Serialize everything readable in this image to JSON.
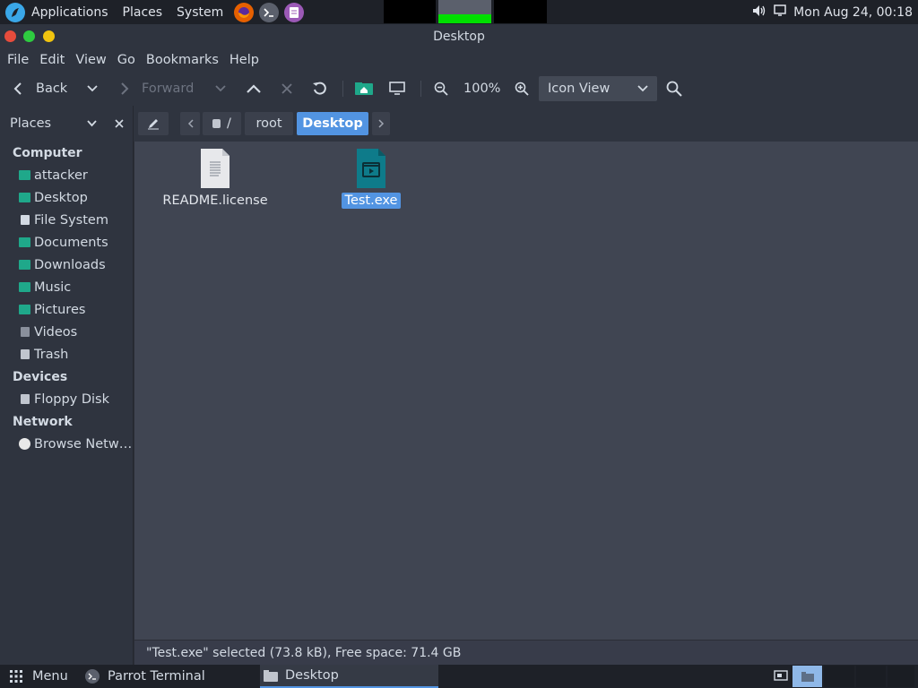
{
  "top_panel": {
    "applications": "Applications",
    "places": "Places",
    "system": "System",
    "launchers": [
      "firefox-icon",
      "terminal-icon",
      "text-editor-icon"
    ],
    "clock": "Mon Aug 24, 00:18"
  },
  "window": {
    "title": "Desktop"
  },
  "menubar": {
    "file": "File",
    "edit": "Edit",
    "view": "View",
    "go": "Go",
    "bookmarks": "Bookmarks",
    "help": "Help"
  },
  "toolbar": {
    "back": "Back",
    "forward": "Forward",
    "zoom": "100%",
    "view_mode": "Icon View"
  },
  "sidebar": {
    "header": "Places",
    "sections": [
      {
        "title": "Computer"
      },
      {
        "title": "Devices"
      },
      {
        "title": "Network"
      }
    ],
    "computer_items": [
      "attacker",
      "Desktop",
      "File System",
      "Documents",
      "Downloads",
      "Music",
      "Pictures",
      "Videos",
      "Trash"
    ],
    "device_items": [
      "Floppy Disk"
    ],
    "network_items": [
      "Browse Netw…"
    ]
  },
  "pathbar": {
    "crumbs": [
      "/",
      "root",
      "Desktop"
    ]
  },
  "files": [
    {
      "name": "README.license",
      "icon": "text-file-icon",
      "selected": false
    },
    {
      "name": "Test.exe",
      "icon": "executable-file-icon",
      "selected": true
    }
  ],
  "status": "\"Test.exe\" selected (73.8 kB), Free space: 71.4 GB",
  "bottom_panel": {
    "menu": "Menu",
    "tasks": [
      "Parrot Terminal",
      "Desktop"
    ]
  },
  "colors": {
    "accent": "#5294e2",
    "close": "#e74c3c",
    "minimize": "#2ecc40",
    "maximize": "#f1c40f",
    "folder": "#1fa88a"
  }
}
